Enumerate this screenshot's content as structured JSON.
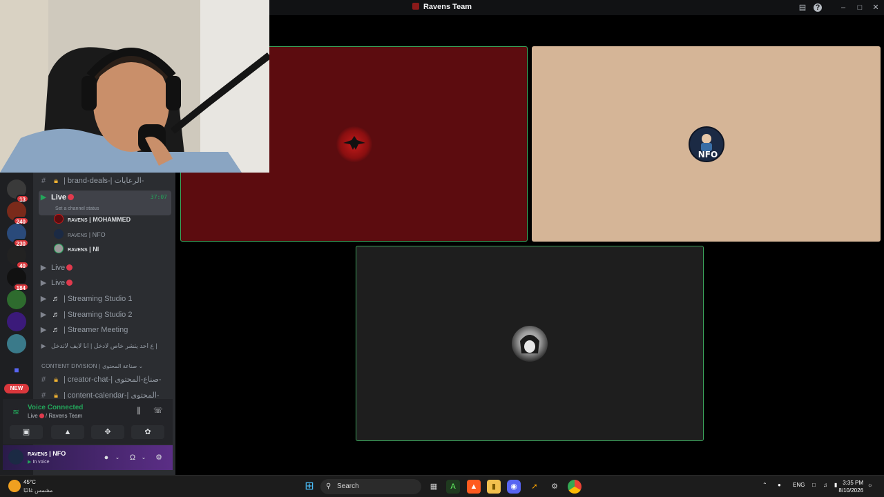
{
  "window": {
    "title": "Ravens Team",
    "controls": [
      "inbox-icon",
      "help-icon",
      "minimize-icon",
      "maximize-icon",
      "close-icon"
    ]
  },
  "servers": [
    {
      "name": "server-1",
      "badge": "13",
      "color": "#3a3a3a"
    },
    {
      "name": "server-2",
      "badge": "240",
      "color": "#7a2a1a"
    },
    {
      "name": "server-3",
      "badge": "230",
      "color": "#2a4a7a"
    },
    {
      "name": "server-4",
      "badge": "40",
      "color": "#222"
    },
    {
      "name": "server-5",
      "badge": "184",
      "color": "#111"
    },
    {
      "name": "server-6",
      "badge": "",
      "color": "#2e6b2e"
    },
    {
      "name": "server-7",
      "badge": "",
      "color": "#3b1a7a"
    },
    {
      "name": "server-8",
      "badge": "",
      "color": "#3a7a8a"
    },
    {
      "name": "server-9",
      "badge": "",
      "color": "#5865f2"
    }
  ],
  "new_badge": "NEW",
  "channels": {
    "brand_deals": "| brand-deals-| الرعايات-",
    "live_active": {
      "label": "Live",
      "status": "Set a channel status",
      "timer": "37:07",
      "users": [
        {
          "tag": "RAVENS",
          "name": "| MOHAMMED"
        },
        {
          "tag": "RAVENS",
          "name": "| NFO"
        },
        {
          "tag": "RAVENS",
          "name": "| NI"
        }
      ]
    },
    "live_2": "Live",
    "live_3": "Live",
    "studio_1": "| Streaming Studio 1",
    "studio_2": "| Streaming Studio 2",
    "meeting": "| Streamer Meeting",
    "arabic_channel": "ع احد يتشر خاص لادخل | انا لايف لاتدخل |",
    "category": "CONTENT DIVISION | صناعة المحتوى",
    "creator_chat": "| creator-chat-| صناع-المحتوى-",
    "content_calendar": "| content-calendar-| المحتوى-"
  },
  "voice": {
    "title": "Voice Connected",
    "channel": "Live",
    "server": "/ Ravens Team"
  },
  "user": {
    "tag": "RAVENS",
    "name": "| NFO",
    "status": "In voice"
  },
  "tiles": [
    {
      "name": "ravens-mohammed-tile",
      "bg": "#5c0c0f"
    },
    {
      "name": "ravens-nfo-tile",
      "bg": "#d5b597"
    },
    {
      "name": "ravens-ni-tile",
      "bg": "#1e1e1e"
    }
  ],
  "taskbar": {
    "temp": "45°C",
    "weather": "مشمس غالبًا",
    "search_placeholder": "Search",
    "lang": "ENG",
    "time": "3:35 PM",
    "date": "8/10/2026"
  }
}
